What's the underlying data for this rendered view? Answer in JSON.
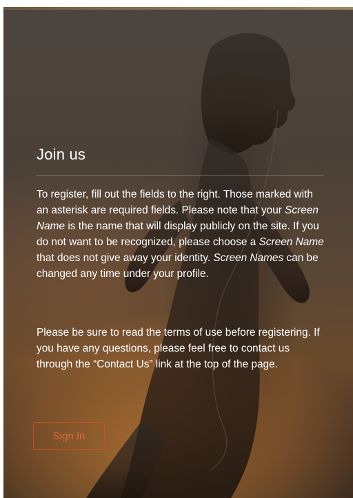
{
  "panel": {
    "title": "Join us",
    "intro": {
      "p1": "To register, fill out the fields to the right.  Those marked with an asterisk are required fields.  Please note that your ",
      "em1": "Screen Name",
      "p2": " is the name that will display publicly on the site.  If you do not want to be recognized, please choose a ",
      "em2": "Screen Name",
      "p3": " that does not give away your identity.  ",
      "em3": "Screen Names",
      "p4": " can be changed any time under your profile."
    },
    "terms": "Please be sure to read the terms of use before registering.  If you have any questions, please feel free to contact us through the “Contact Us” link at the top of the page.",
    "signin_label": "Sign In"
  },
  "colors": {
    "accent": "#e0683a",
    "accent_border": "#c4542a",
    "text": "#ffffff",
    "panel_bg": "#4b4139"
  }
}
